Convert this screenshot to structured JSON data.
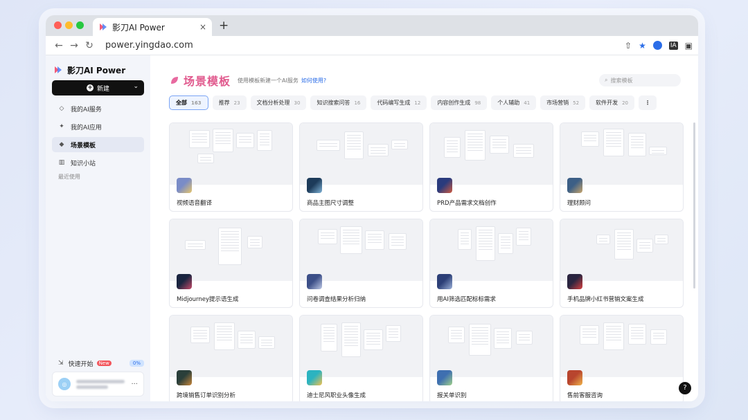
{
  "browser": {
    "tab_title": "影刀AI Power",
    "tab_close": "×",
    "new_tab": "+",
    "url": "power.yingdao.com"
  },
  "sidebar": {
    "brand": "影刀AI Power",
    "new_button": "新建",
    "items": [
      {
        "label": "我的AI服务",
        "icon": "◇"
      },
      {
        "label": "我的AI应用",
        "icon": "✦"
      },
      {
        "label": "场景模板",
        "icon": "◆"
      },
      {
        "label": "知识小站",
        "icon": "▥"
      }
    ],
    "recent_label": "最近使用",
    "quick_start": "快速开始",
    "new_badge": "New",
    "progress": "0%"
  },
  "main": {
    "title": "场景模板",
    "subtitle": "使用模板新建一个AI服务",
    "howto": "如何使用?",
    "search_placeholder": "搜索模板",
    "categories": [
      {
        "label": "全部",
        "count": "163"
      },
      {
        "label": "推荐",
        "count": "23"
      },
      {
        "label": "文档分析处理",
        "count": "30"
      },
      {
        "label": "知识搜索问答",
        "count": "16"
      },
      {
        "label": "代码编写生成",
        "count": "12"
      },
      {
        "label": "内容创作生成",
        "count": "98"
      },
      {
        "label": "个人辅助",
        "count": "41"
      },
      {
        "label": "市场营销",
        "count": "52"
      },
      {
        "label": "软件开发",
        "count": "20"
      }
    ],
    "more": "⋮",
    "cards": [
      {
        "title": "视频语音翻译",
        "icon_colors": [
          "#7a8cc7",
          "#e8c66a"
        ]
      },
      {
        "title": "商品主图尺寸调整",
        "icon_colors": [
          "#1d3b5a",
          "#7fb2d6"
        ]
      },
      {
        "title": "PRD产品需求文档创作",
        "icon_colors": [
          "#2a3b7d",
          "#d15a3f"
        ]
      },
      {
        "title": "理财顾问",
        "icon_colors": [
          "#3c5f86",
          "#c9a56b"
        ]
      },
      {
        "title": "Midjourney提示语生成",
        "icon_colors": [
          "#1a2540",
          "#c84a6a"
        ]
      },
      {
        "title": "问卷调查结果分析归纳",
        "icon_colors": [
          "#3c4f88",
          "#bfc9e6"
        ]
      },
      {
        "title": "用AI筛选匹配标标需求",
        "icon_colors": [
          "#2c3f77",
          "#9bb0d8"
        ]
      },
      {
        "title": "手机品牌小红书营销文案生成",
        "icon_colors": [
          "#2a2540",
          "#d94040"
        ]
      },
      {
        "title": "跨境销售订单识别分析",
        "icon_colors": [
          "#2a3f3a",
          "#c8863a"
        ]
      },
      {
        "title": "迪士尼风职业头像生成",
        "icon_colors": [
          "#2bb3c0",
          "#f2c14e"
        ]
      },
      {
        "title": "报关单识别",
        "icon_colors": [
          "#3e6fb0",
          "#9fd18a"
        ]
      },
      {
        "title": "售前客服咨询",
        "icon_colors": [
          "#b8452e",
          "#f0b34a"
        ]
      }
    ],
    "help": "?"
  }
}
